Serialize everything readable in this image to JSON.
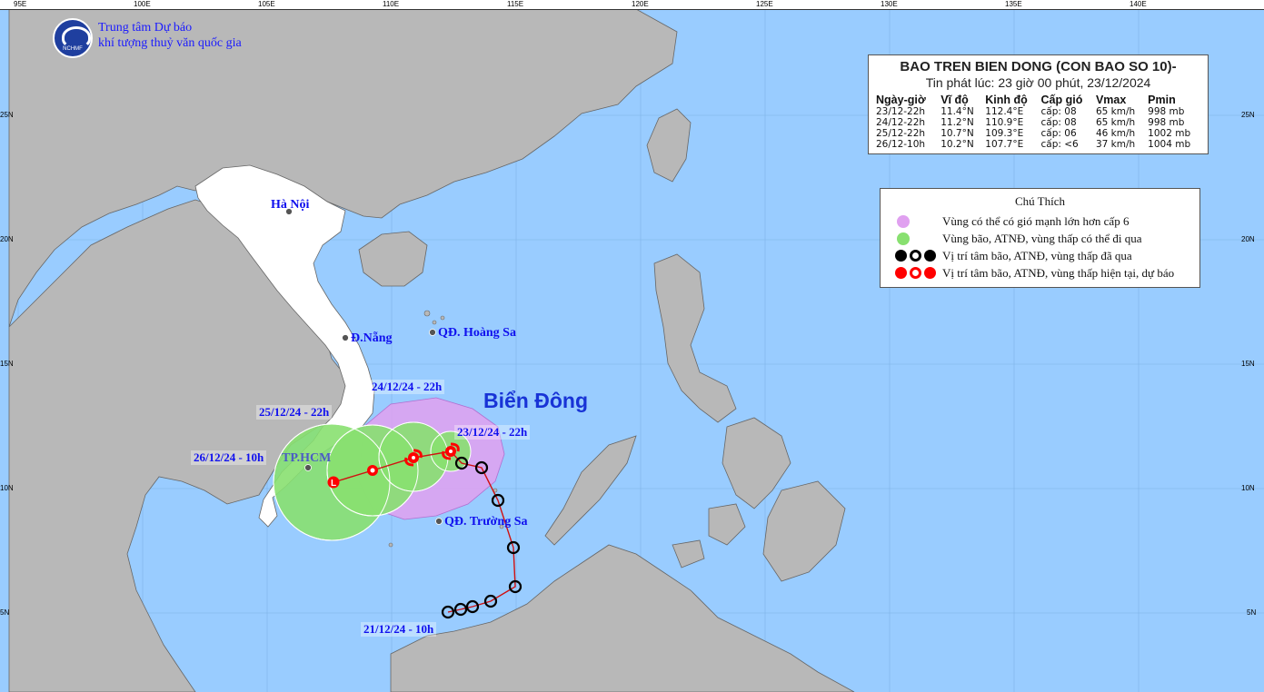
{
  "organization": {
    "name_line1": "Trung tâm Dự báo",
    "name_line2": "khí tượng thuỷ văn quốc gia",
    "logo_text": "NCHMF"
  },
  "axes": {
    "lon_labels": [
      "95E",
      "100E",
      "105E",
      "110E",
      "115E",
      "120E",
      "125E",
      "130E",
      "135E",
      "140E"
    ],
    "lat_labels_left": [
      "25N",
      "20N",
      "15N",
      "10N",
      "5N"
    ],
    "lat_labels_right": [
      "25N",
      "20N",
      "15N",
      "10N",
      "5N"
    ]
  },
  "places": {
    "hanoi": "Hà Nội",
    "danang": "Đ.Nẵng",
    "hoangsa": "QĐ. Hoàng Sa",
    "hcm": "TP.HCM",
    "truongsa": "QĐ. Trường Sa",
    "sea": "Biển Đông"
  },
  "track_labels": {
    "t1": "24/12/24 - 22h",
    "t2": "25/12/24 - 22h",
    "t3": "26/12/24 - 10h",
    "t4": "23/12/24 - 22h",
    "t5": "21/12/24 - 10h"
  },
  "bulletin": {
    "title": "BAO TREN BIEN DONG (CON BAO SO 10)-",
    "issued": "Tin phát lúc: 23 giờ 00 phút, 23/12/2024",
    "headers": [
      "Ngày-giờ",
      "Vĩ độ",
      "Kinh độ",
      "Cấp gió",
      "Vmax",
      "Pmin"
    ],
    "rows": [
      [
        "23/12-22h",
        "11.4°N",
        "112.4°E",
        "cấp: 08",
        "65 km/h",
        "998 mb"
      ],
      [
        "24/12-22h",
        "11.2°N",
        "110.9°E",
        "cấp: 08",
        "65 km/h",
        "998 mb"
      ],
      [
        "25/12-22h",
        "10.7°N",
        "109.3°E",
        "cấp: 06",
        "46 km/h",
        "1002 mb"
      ],
      [
        "26/12-10h",
        "10.2°N",
        "107.7°E",
        "cấp: <6",
        "37 km/h",
        "1004 mb"
      ]
    ]
  },
  "legend": {
    "title": "Chú Thích",
    "items": [
      {
        "text": "Vùng có thể có gió mạnh lớn hơn cấp 6",
        "color": "#e0a0f0"
      },
      {
        "text": "Vùng bão, ATNĐ, vùng thấp có thể đi qua",
        "color": "#88e070"
      },
      {
        "text": "Vị trí tâm bão, ATNĐ, vùng thấp đã qua",
        "color": "#000000"
      },
      {
        "text": "Vị trí tâm bão, ATNĐ, vùng thấp hiện tại, dự báo",
        "color": "#ff0000"
      }
    ]
  },
  "colors": {
    "sea": "#99ccff",
    "land": "#b8b8b8",
    "vietnam": "#ffffff",
    "track": "#d01010",
    "past": "#000000",
    "forecast": "#ff0000",
    "strong_wind_zone": "#e0a0f0",
    "storm_zone": "#88e070"
  }
}
